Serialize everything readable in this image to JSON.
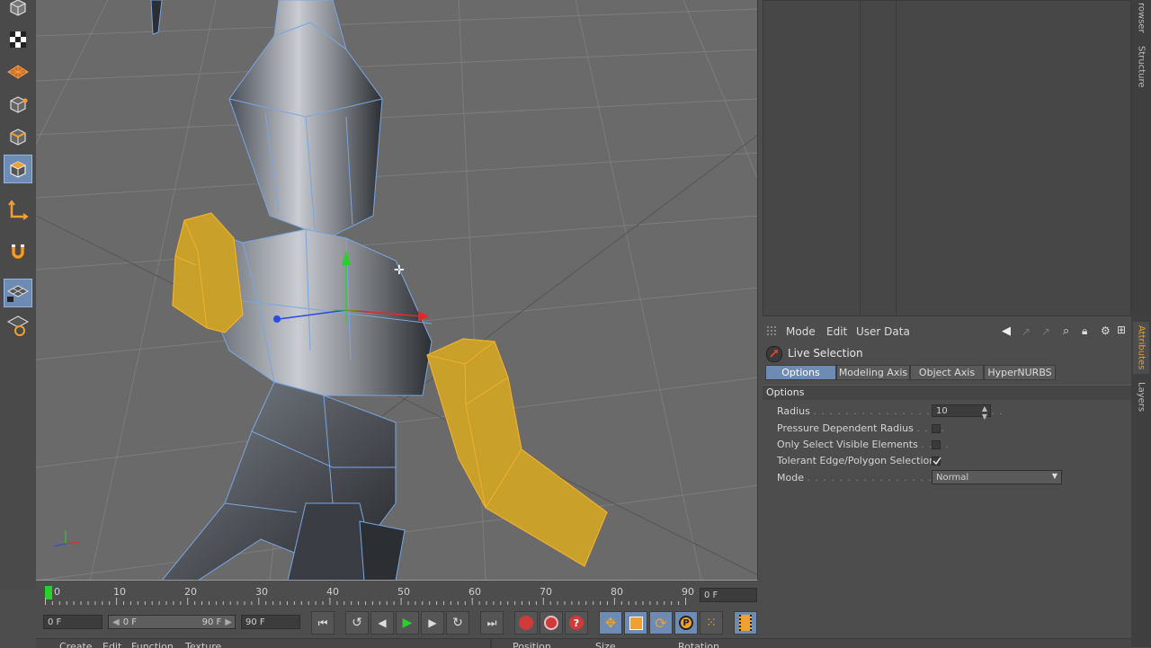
{
  "attributes": {
    "menu": [
      "Mode",
      "Edit",
      "User Data"
    ],
    "tool_name": "Live Selection",
    "tabs": [
      {
        "label": "Options",
        "active": true
      },
      {
        "label": "Modeling Axis",
        "active": false
      },
      {
        "label": "Object Axis",
        "active": false
      },
      {
        "label": "HyperNURBS",
        "active": false
      }
    ],
    "section_title": "Options",
    "radius": {
      "label": "Radius",
      "value": "10"
    },
    "pressure_radius": {
      "label": "Pressure Dependent Radius",
      "checked": false
    },
    "visible_only": {
      "label": "Only Select Visible Elements",
      "checked": false
    },
    "tolerant": {
      "label": "Tolerant Edge/Polygon Selection",
      "checked": true
    },
    "mode": {
      "label": "Mode",
      "value": "Normal"
    }
  },
  "side_tabs": [
    "rowser",
    "Structure",
    "Attributes",
    "Layers"
  ],
  "timeline": {
    "ticks": [
      "0",
      "10",
      "20",
      "30",
      "40",
      "50",
      "60",
      "70",
      "80",
      "90"
    ],
    "current_frame": "0 F"
  },
  "transport": {
    "start": "0 F",
    "range_start": "0 F",
    "range_end": "90 F",
    "end": "90 F"
  },
  "bottom": {
    "menu": [
      "Create",
      "Edit",
      "Function",
      "Texture"
    ],
    "coords": [
      "Position",
      "Size",
      "Rotation"
    ]
  },
  "colors": {
    "accent": "#e2a22b",
    "selection_blue": "#6d8bb3",
    "selected_polygon": "#c9a02a"
  }
}
